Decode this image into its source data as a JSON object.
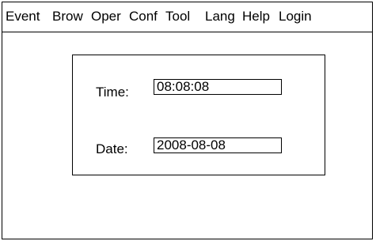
{
  "menubar": {
    "items": [
      {
        "label": "Event"
      },
      {
        "label": "Brow"
      },
      {
        "label": "Oper"
      },
      {
        "label": "Conf"
      },
      {
        "label": "Tool"
      },
      {
        "label": "Lang"
      },
      {
        "label": "Help"
      },
      {
        "label": "Login"
      }
    ]
  },
  "datetime_panel": {
    "time_label": "Time:",
    "time_value": "08:08:08",
    "date_label": "Date:",
    "date_value": "2008-08-08"
  }
}
